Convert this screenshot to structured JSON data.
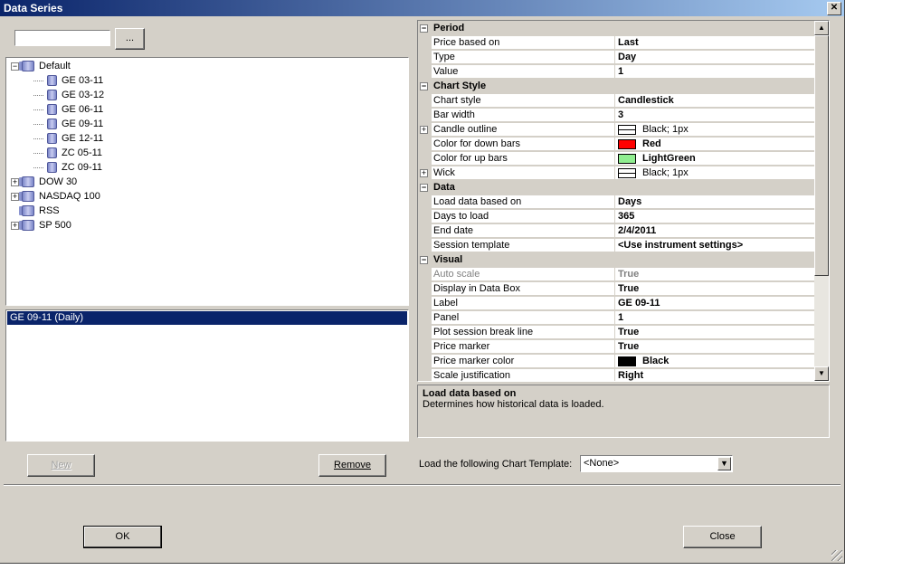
{
  "window": {
    "title": "Data Series",
    "close_glyph": "✕"
  },
  "search": {
    "value": "",
    "browse_label": "..."
  },
  "tree": [
    {
      "label": "Default",
      "expander": "−",
      "children": [
        "GE 03-11",
        "GE 03-12",
        "GE 06-11",
        "GE 09-11",
        "GE 12-11",
        "ZC 05-11",
        "ZC 09-11"
      ]
    },
    {
      "label": "DOW 30",
      "expander": "+"
    },
    {
      "label": "NASDAQ 100",
      "expander": "+"
    },
    {
      "label": "RSS",
      "expander": ""
    },
    {
      "label": "SP 500",
      "expander": "+"
    }
  ],
  "selected_series": [
    "GE 09-11 (Daily)"
  ],
  "buttons": {
    "new": "New",
    "remove": "Remove",
    "ok": "OK",
    "close": "Close"
  },
  "properties": {
    "period": {
      "title": "Period",
      "rows": [
        [
          "Price based on",
          "Last"
        ],
        [
          "Type",
          "Day"
        ],
        [
          "Value",
          "1"
        ]
      ]
    },
    "chart_style": {
      "title": "Chart Style",
      "chart_style": [
        "Chart style",
        "Candlestick"
      ],
      "bar_width": [
        "Bar width",
        "3"
      ],
      "candle_outline": [
        "Candle outline",
        "Black; 1px"
      ],
      "down": [
        "Color for down bars",
        "Red",
        "#ff0000"
      ],
      "up": [
        "Color for up bars",
        "LightGreen",
        "#90ee90"
      ],
      "wick": [
        "Wick",
        "Black; 1px"
      ]
    },
    "data": {
      "title": "Data",
      "rows": [
        [
          "Load data based on",
          "Days"
        ],
        [
          "Days to load",
          "365"
        ],
        [
          "End date",
          "2/4/2011"
        ],
        [
          "Session template",
          "<Use instrument settings>"
        ]
      ]
    },
    "visual": {
      "title": "Visual",
      "auto_scale": [
        "Auto scale",
        "True"
      ],
      "rows": [
        [
          "Display in Data Box",
          "True"
        ],
        [
          "Label",
          "GE 09-11"
        ],
        [
          "Panel",
          "1"
        ],
        [
          "Plot session break line",
          "True"
        ],
        [
          "Price marker",
          "True"
        ]
      ],
      "price_marker_color": [
        "Price marker color",
        "Black",
        "#000000"
      ],
      "scale_justification": [
        "Scale justification",
        "Right"
      ]
    }
  },
  "description": {
    "title": "Load data based on",
    "text": "Determines how historical data is loaded."
  },
  "template": {
    "label": "Load the following Chart Template:",
    "value": "<None>"
  }
}
